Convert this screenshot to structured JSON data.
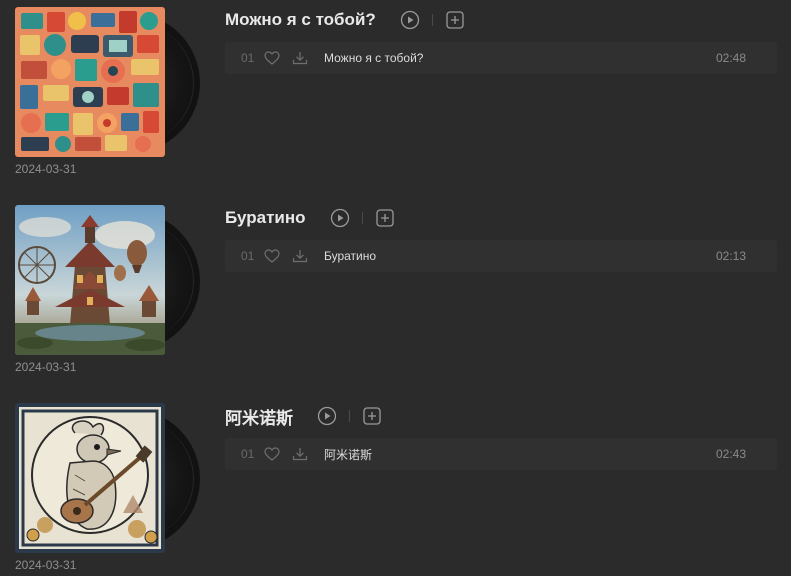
{
  "albums": [
    {
      "title": "Можно я с тобой?",
      "date": "2024-03-31",
      "cover_icon": "collage-art-image",
      "tracks": [
        {
          "number": "01",
          "name": "Можно я с тобой?",
          "duration": "02:48"
        }
      ]
    },
    {
      "title": "Буратино",
      "date": "2024-03-31",
      "cover_icon": "fantasy-castle-image",
      "tracks": [
        {
          "number": "01",
          "name": "Буратино",
          "duration": "02:13"
        }
      ]
    },
    {
      "title": "阿米诺斯",
      "date": "2024-03-31",
      "cover_icon": "bird-guitar-image",
      "tracks": [
        {
          "number": "01",
          "name": "阿米诺斯",
          "duration": "02:43"
        }
      ]
    }
  ]
}
